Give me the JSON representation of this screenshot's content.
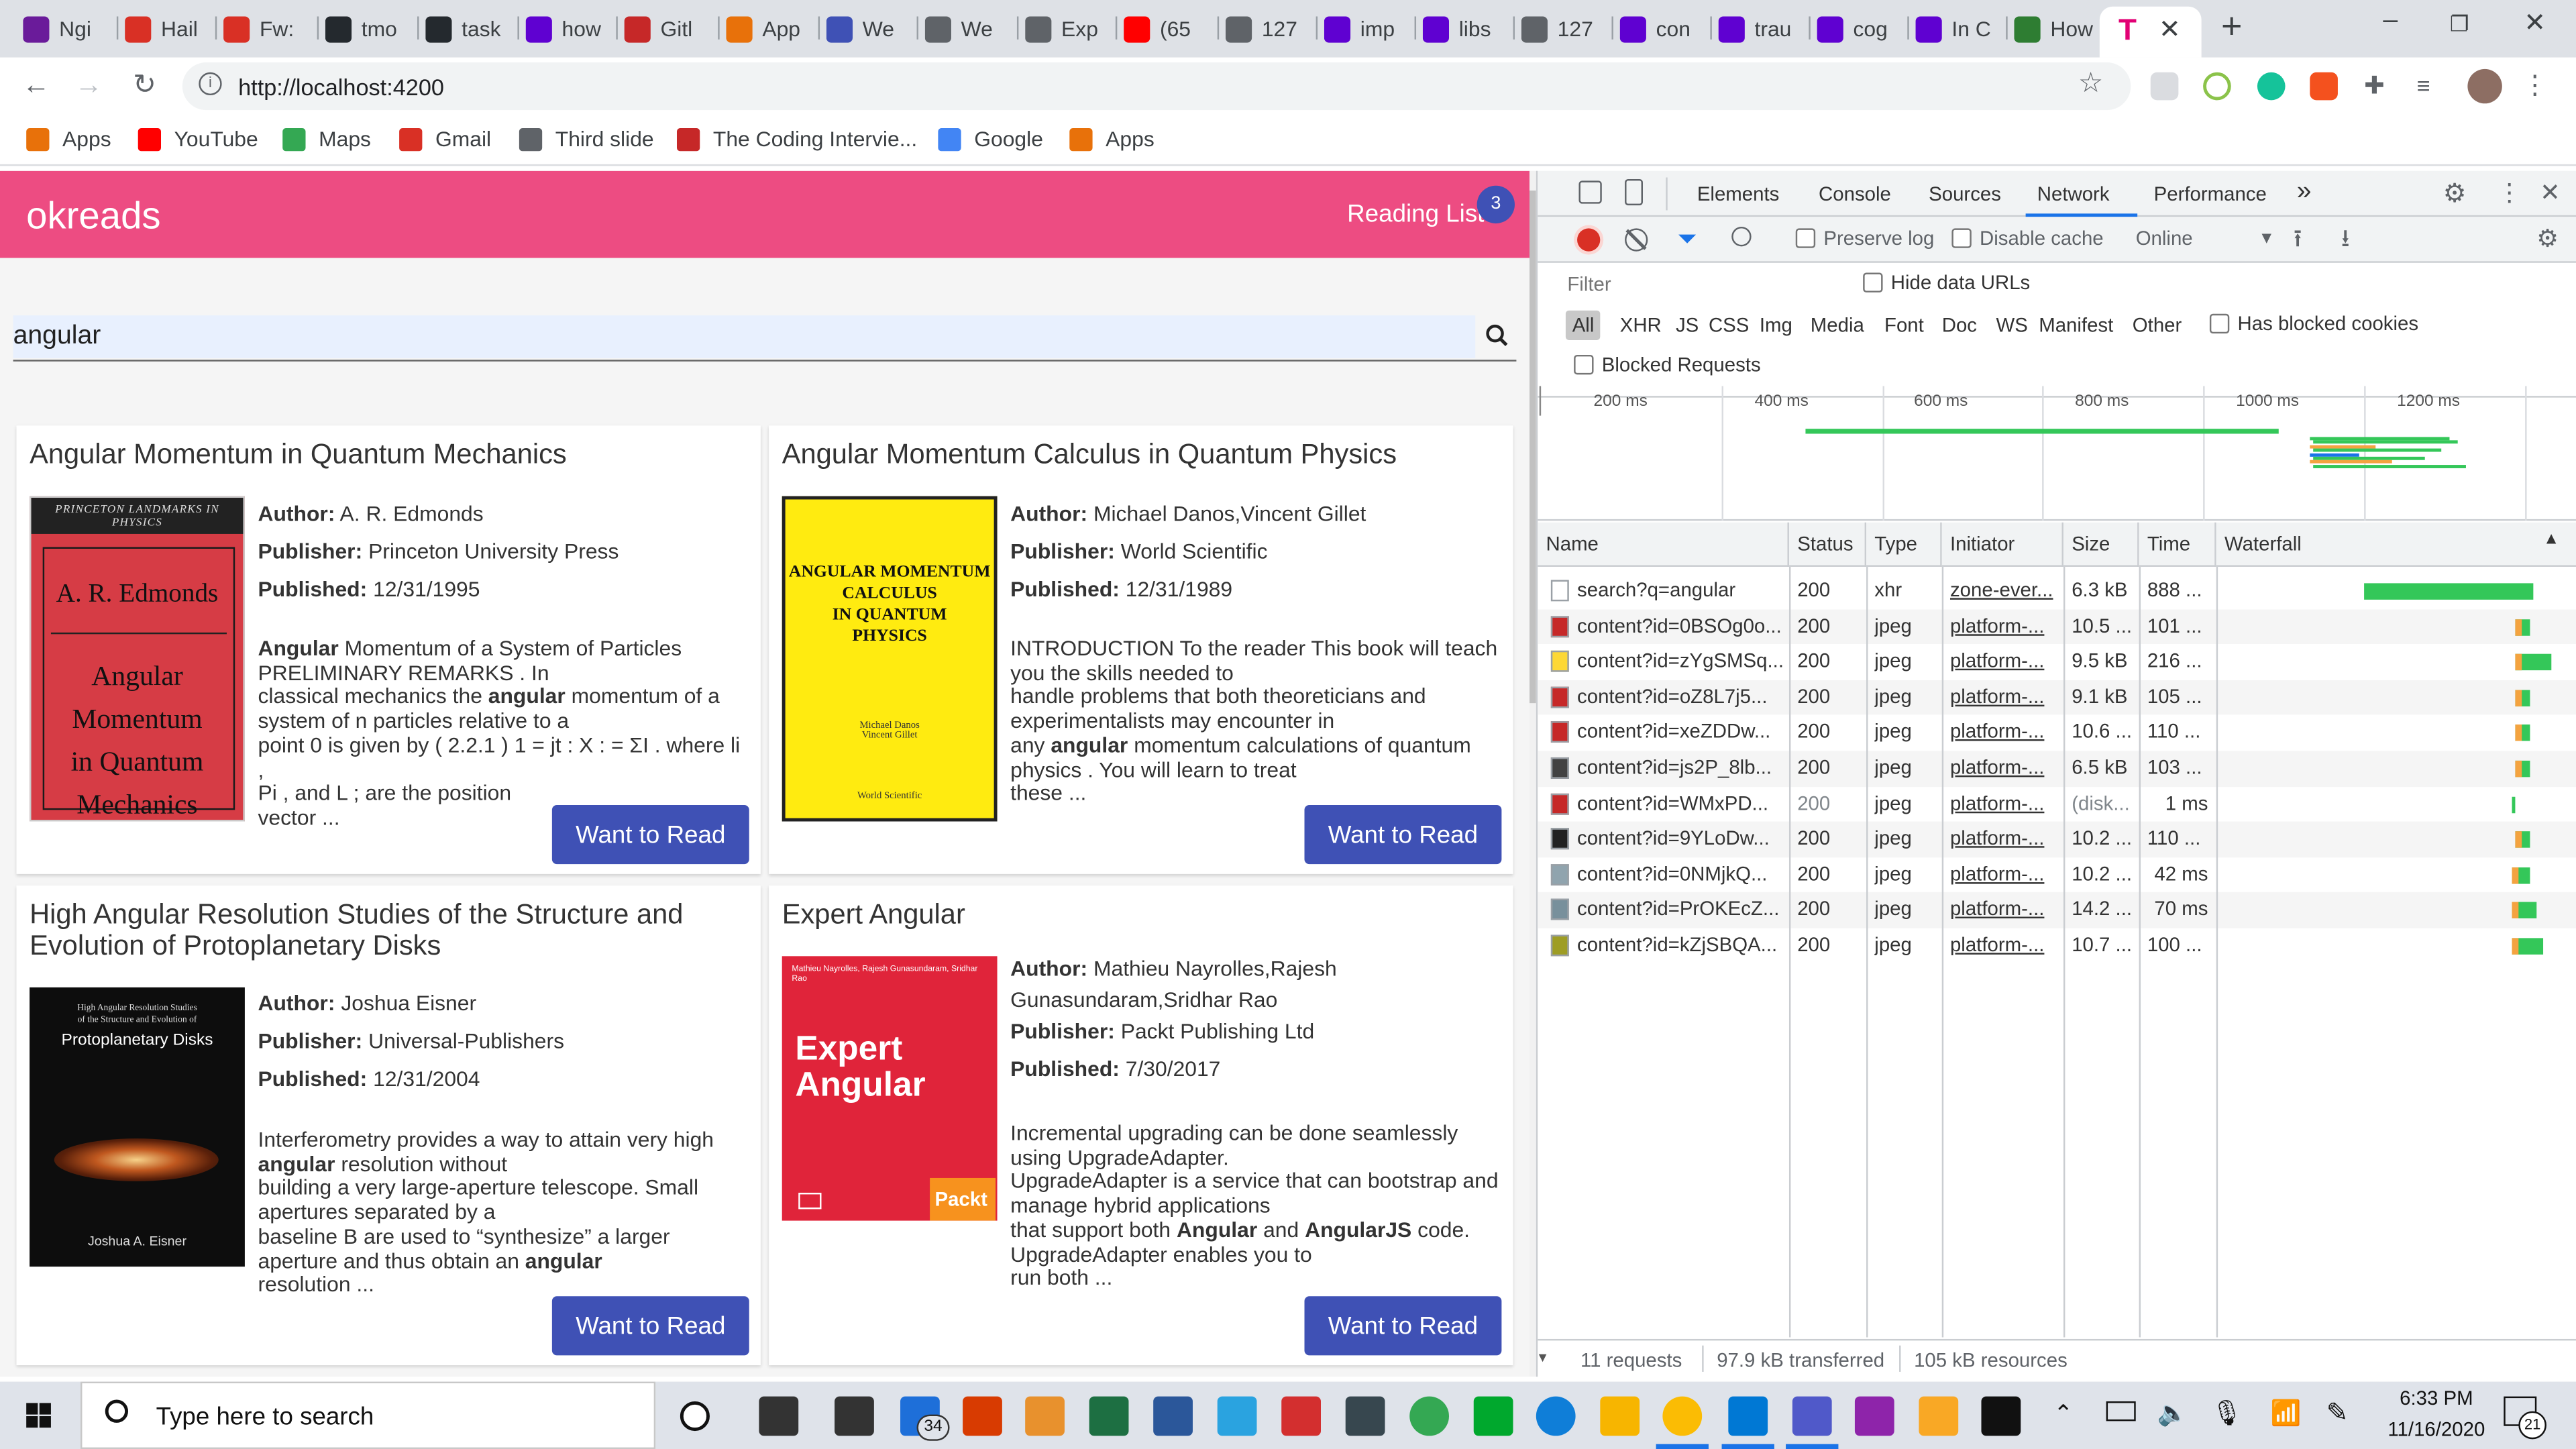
{
  "browser": {
    "tabs": [
      {
        "label": "Ngi",
        "icon": "ngrx-icon",
        "color": "#6a1b9a"
      },
      {
        "label": "Hail",
        "icon": "gmail-icon",
        "color": "#d93025"
      },
      {
        "label": "Fw:",
        "icon": "gmail-icon",
        "color": "#d93025"
      },
      {
        "label": "tmo",
        "icon": "github-icon",
        "color": "#24292e"
      },
      {
        "label": "task",
        "icon": "github-icon",
        "color": "#24292e"
      },
      {
        "label": "how",
        "icon": "yahoo-icon",
        "color": "#5f01d1"
      },
      {
        "label": "Gitl",
        "icon": "coding-interview-icon",
        "color": "#c62828"
      },
      {
        "label": "App",
        "icon": "apps-grid-icon",
        "color": "#e8710a"
      },
      {
        "label": "We",
        "icon": "u-icon",
        "color": "#3f51b5"
      },
      {
        "label": "We",
        "icon": "puzzle-icon",
        "color": "#5f6368"
      },
      {
        "label": "Exp",
        "icon": "globe-icon",
        "color": "#5f6368"
      },
      {
        "label": "(65",
        "icon": "youtube-icon",
        "color": "#ff0000"
      },
      {
        "label": "127",
        "icon": "globe-icon",
        "color": "#5f6368"
      },
      {
        "label": "imp",
        "icon": "yahoo-icon",
        "color": "#5f01d1"
      },
      {
        "label": "libs",
        "icon": "yahoo-icon",
        "color": "#5f01d1"
      },
      {
        "label": "127",
        "icon": "globe-icon",
        "color": "#5f6368"
      },
      {
        "label": "con",
        "icon": "yahoo-icon",
        "color": "#5f01d1"
      },
      {
        "label": "trau",
        "icon": "yahoo-icon",
        "color": "#5f01d1"
      },
      {
        "label": "cog",
        "icon": "yahoo-icon",
        "color": "#5f01d1"
      },
      {
        "label": "In C",
        "icon": "yahoo-icon",
        "color": "#5f01d1"
      },
      {
        "label": "How",
        "icon": "w-icon",
        "color": "#2e7d32"
      }
    ],
    "new_tab": "+",
    "url": "http://localhost:4200",
    "bookmarks": [
      {
        "label": "Apps",
        "icon": "apps-grid-icon",
        "color": "#e8710a"
      },
      {
        "label": "YouTube",
        "icon": "youtube-icon",
        "color": "#ff0000"
      },
      {
        "label": "Maps",
        "icon": "maps-pin-icon",
        "color": "#34a853"
      },
      {
        "label": "Gmail",
        "icon": "gmail-icon",
        "color": "#d93025"
      },
      {
        "label": "Third slide",
        "icon": "globe-icon",
        "color": "#5f6368"
      },
      {
        "label": "The Coding Intervie...",
        "icon": "coding-interview-icon",
        "color": "#c62828"
      },
      {
        "label": "Google",
        "icon": "google-icon",
        "color": "#4285f4"
      },
      {
        "label": "Apps",
        "icon": "apps-grid-icon",
        "color": "#e8710a"
      }
    ]
  },
  "app": {
    "brand": "okreads",
    "reading_list_label": "Reading List",
    "reading_list_count": "3",
    "search_value": "angular",
    "want_label": "Want to Read",
    "labels": {
      "author": "Author:",
      "publisher": "Publisher:",
      "published": "Published:"
    },
    "books": [
      {
        "title": "Angular Momentum in Quantum Mechanics",
        "author": "A. R. Edmonds",
        "publisher": "Princeton University Press",
        "published": "12/31/1995",
        "desc": [
          [
            {
              "b": true,
              "t": "Angular"
            },
            {
              "t": " Momentum of a System of Particles"
            }
          ],
          [
            {
              "t": "PRELIMINARY REMARKS . In"
            }
          ],
          [
            {
              "t": "classical mechanics the "
            },
            {
              "b": true,
              "t": "angular"
            },
            {
              "t": " momentum of a"
            }
          ],
          [
            {
              "t": "system of n particles relative to a"
            }
          ],
          [
            {
              "t": "point 0 is given by ( 2.2.1 ) 1 = jt : X : = ΣI . where li ,"
            }
          ],
          [
            {
              "t": "Pi , and L ; are the position"
            }
          ],
          [
            {
              "t": "vector ..."
            }
          ]
        ],
        "cover": {
          "top": "PRINCETON LANDMARKS IN PHYSICS",
          "author": "A. R. Edmonds",
          "title": [
            "Angular Momentum",
            "in Quantum",
            "Mechanics"
          ]
        }
      },
      {
        "title": "Angular Momentum Calculus in Quantum Physics",
        "author": "Michael Danos,Vincent Gillet",
        "publisher": "World Scientific",
        "published": "12/31/1989",
        "desc": [
          [
            {
              "t": "INTRODUCTION To the reader This book will teach"
            }
          ],
          [
            {
              "t": "you the skills needed to"
            }
          ],
          [
            {
              "t": "handle problems that both theoreticians and"
            }
          ],
          [
            {
              "t": "experimentalists may encounter in"
            }
          ],
          [
            {
              "t": "any "
            },
            {
              "b": true,
              "t": "angular"
            },
            {
              "t": " momentum calculations of quantum"
            }
          ],
          [
            {
              "t": "physics . You will learn to treat"
            }
          ],
          [
            {
              "t": "these ..."
            }
          ]
        ],
        "cover": {
          "title": [
            "ANGULAR MOMENTUM",
            "CALCULUS",
            "IN QUANTUM",
            "PHYSICS"
          ],
          "author": "Michael Danos\nVincent Gillet",
          "publisher": "World Scientific"
        }
      },
      {
        "title": "High Angular Resolution Studies of the Structure and Evolution of Protoplanetary Disks",
        "author": "Joshua Eisner",
        "publisher": "Universal-Publishers",
        "published": "12/31/2004",
        "desc": [
          [
            {
              "t": "Interferometry provides a way to attain very high"
            }
          ],
          [
            {
              "b": true,
              "t": "angular"
            },
            {
              "t": " resolution without"
            }
          ],
          [
            {
              "t": "building a very large-aperture telescope. Small"
            }
          ],
          [
            {
              "t": "apertures separated by a"
            }
          ],
          [
            {
              "t": "baseline B are used to “synthesize” a larger"
            }
          ],
          [
            {
              "t": "aperture and thus obtain an "
            },
            {
              "b": true,
              "t": "angular"
            }
          ],
          [
            {
              "t": "resolution ..."
            }
          ]
        ],
        "cover": {
          "title": [
            "High Angular Resolution Studies",
            "of the Structure and Evolution of"
          ],
          "big": "Protoplanetary Disks",
          "author": "Joshua A. Eisner"
        }
      },
      {
        "title": "Expert Angular",
        "author": "Mathieu Nayrolles,Rajesh Gunasundaram,Sridhar Rao",
        "publisher": "Packt Publishing Ltd",
        "published": "7/30/2017",
        "desc": [
          [
            {
              "t": "Incremental upgrading can be done seamlessly"
            }
          ],
          [
            {
              "t": "using UpgradeAdapter."
            }
          ],
          [
            {
              "t": "UpgradeAdapter is a service that can bootstrap and"
            }
          ],
          [
            {
              "t": "manage hybrid applications"
            }
          ],
          [
            {
              "t": "that support both "
            },
            {
              "b": true,
              "t": "Angular"
            },
            {
              "t": " and "
            },
            {
              "b": true,
              "t": "AngularJS"
            },
            {
              "t": " code."
            }
          ],
          [
            {
              "t": "UpgradeAdapter enables you to"
            }
          ],
          [
            {
              "t": "run both ..."
            }
          ]
        ],
        "cover": {
          "authors": "Mathieu Nayrolles, Rajesh Gunasundaram, Sridhar Rao",
          "title": [
            "Expert",
            "Angular"
          ],
          "publisher": "Packt"
        }
      }
    ]
  },
  "devtools": {
    "tabs": [
      "Elements",
      "Console",
      "Sources",
      "Network",
      "Performance"
    ],
    "active_tab": "Network",
    "more": "»",
    "preserve_log": "Preserve log",
    "disable_cache": "Disable cache",
    "throttle": "Online",
    "filter_placeholder": "Filter",
    "hide_data_urls": "Hide data URLs",
    "types": [
      "All",
      "XHR",
      "JS",
      "CSS",
      "Img",
      "Media",
      "Font",
      "Doc",
      "WS",
      "Manifest",
      "Other"
    ],
    "has_blocked_cookies": "Has blocked cookies",
    "blocked_requests": "Blocked Requests",
    "timeline_ticks": [
      "200 ms",
      "400 ms",
      "600 ms",
      "800 ms",
      "1000 ms",
      "1200 ms"
    ],
    "columns": [
      "Name",
      "Status",
      "Type",
      "Initiator",
      "Size",
      "Time",
      "Waterfall"
    ],
    "requests": [
      {
        "name": "search?q=angular",
        "status": "200",
        "type": "xhr",
        "initiator": "zone-ever...",
        "size": "6.3 kB",
        "time": "888 ...",
        "icon": "#ffffff",
        "wf_start": 0.45,
        "wf_width": 0.55
      },
      {
        "name": "content?id=0BSOg0o...",
        "status": "200",
        "type": "jpeg",
        "initiator": "platform-...",
        "size": "10.5 ...",
        "time": "101 ...",
        "icon": "#c62828",
        "wf_start": 0.94,
        "wf_width": 0.05
      },
      {
        "name": "content?id=zYgSMSq...",
        "status": "200",
        "type": "jpeg",
        "initiator": "platform-...",
        "size": "9.5 kB",
        "time": "216 ...",
        "icon": "#fdd835",
        "wf_start": 0.94,
        "wf_width": 0.12
      },
      {
        "name": "content?id=oZ8L7j5...",
        "status": "200",
        "type": "jpeg",
        "initiator": "platform-...",
        "size": "9.1 kB",
        "time": "105 ...",
        "icon": "#c62828",
        "wf_start": 0.94,
        "wf_width": 0.05
      },
      {
        "name": "content?id=xeZDDw...",
        "status": "200",
        "type": "jpeg",
        "initiator": "platform-...",
        "size": "10.6 ...",
        "time": "110 ...",
        "icon": "#c62828",
        "wf_start": 0.94,
        "wf_width": 0.05
      },
      {
        "name": "content?id=js2P_8lb...",
        "status": "200",
        "type": "jpeg",
        "initiator": "platform-...",
        "size": "6.5 kB",
        "time": "103 ...",
        "icon": "#424242",
        "wf_start": 0.94,
        "wf_width": 0.05
      },
      {
        "name": "content?id=WMxPD...",
        "status": "200",
        "type": "jpeg",
        "initiator": "platform-...",
        "size": "(disk...",
        "time": "1 ms",
        "icon": "#c62828",
        "wf_start": 0.93,
        "wf_width": 0.005,
        "muted": true
      },
      {
        "name": "content?id=9YLoDw...",
        "status": "200",
        "type": "jpeg",
        "initiator": "platform-...",
        "size": "10.2 ...",
        "time": "110 ...",
        "icon": "#212121",
        "wf_start": 0.94,
        "wf_width": 0.05
      },
      {
        "name": "content?id=0NMjkQ...",
        "status": "200",
        "type": "jpeg",
        "initiator": "platform-...",
        "size": "10.2 ...",
        "time": "42 ms",
        "icon": "#90a4ae",
        "wf_start": 0.93,
        "wf_width": 0.06
      },
      {
        "name": "content?id=PrOKEcZ...",
        "status": "200",
        "type": "jpeg",
        "initiator": "platform-...",
        "size": "14.2 ...",
        "time": "70 ms",
        "icon": "#78909c",
        "wf_start": 0.93,
        "wf_width": 0.08
      },
      {
        "name": "content?id=kZjSBQA...",
        "status": "200",
        "type": "jpeg",
        "initiator": "platform-...",
        "size": "10.7 ...",
        "time": "100 ...",
        "icon": "#9e9d24",
        "wf_start": 0.93,
        "wf_width": 0.1
      }
    ],
    "summary": [
      "11 requests",
      "97.9 kB transferred",
      "105 kB resources"
    ]
  },
  "taskbar": {
    "search_placeholder": "Type here to search",
    "time": "6:33 PM",
    "date": "11/16/2020",
    "mail_badge": "34",
    "notif_count": "21"
  },
  "colors": {
    "accent": "#ed4c82",
    "button": "#3f51b5",
    "waterfall_green": "#34c759",
    "blue": "#1a73e8"
  }
}
